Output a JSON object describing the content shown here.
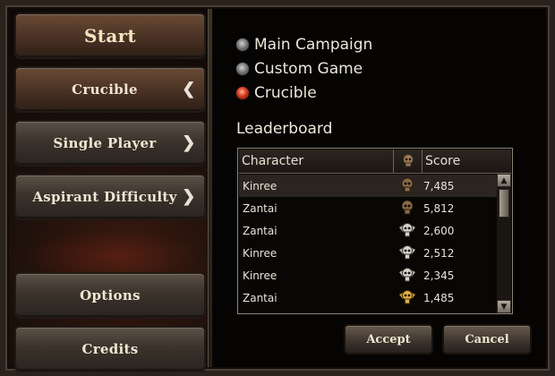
{
  "menu": {
    "start": "Start",
    "crucible": "Crucible",
    "single_player": "Single Player",
    "aspirant_difficulty": "Aspirant Difficulty",
    "options": "Options",
    "credits": "Credits"
  },
  "modes": [
    {
      "label": "Main Campaign",
      "selected": false
    },
    {
      "label": "Custom Game",
      "selected": false
    },
    {
      "label": "Crucible",
      "selected": true
    }
  ],
  "leaderboard": {
    "title": "Leaderboard",
    "columns": {
      "character": "Character",
      "score": "Score"
    },
    "rows": [
      {
        "character": "Kinree",
        "icon": "skull-bronze-icon",
        "score": "7,485"
      },
      {
        "character": "Zantai",
        "icon": "skull-bronze-icon",
        "score": "5,812"
      },
      {
        "character": "Zantai",
        "icon": "skull-silver-winged-icon",
        "score": "2,600"
      },
      {
        "character": "Kinree",
        "icon": "skull-silver-winged-icon",
        "score": "2,512"
      },
      {
        "character": "Kinree",
        "icon": "skull-silver-winged-icon",
        "score": "2,345"
      },
      {
        "character": "Zantai",
        "icon": "skull-gold-winged-icon",
        "score": "1,485"
      }
    ]
  },
  "actions": {
    "accept": "Accept",
    "cancel": "Cancel"
  }
}
